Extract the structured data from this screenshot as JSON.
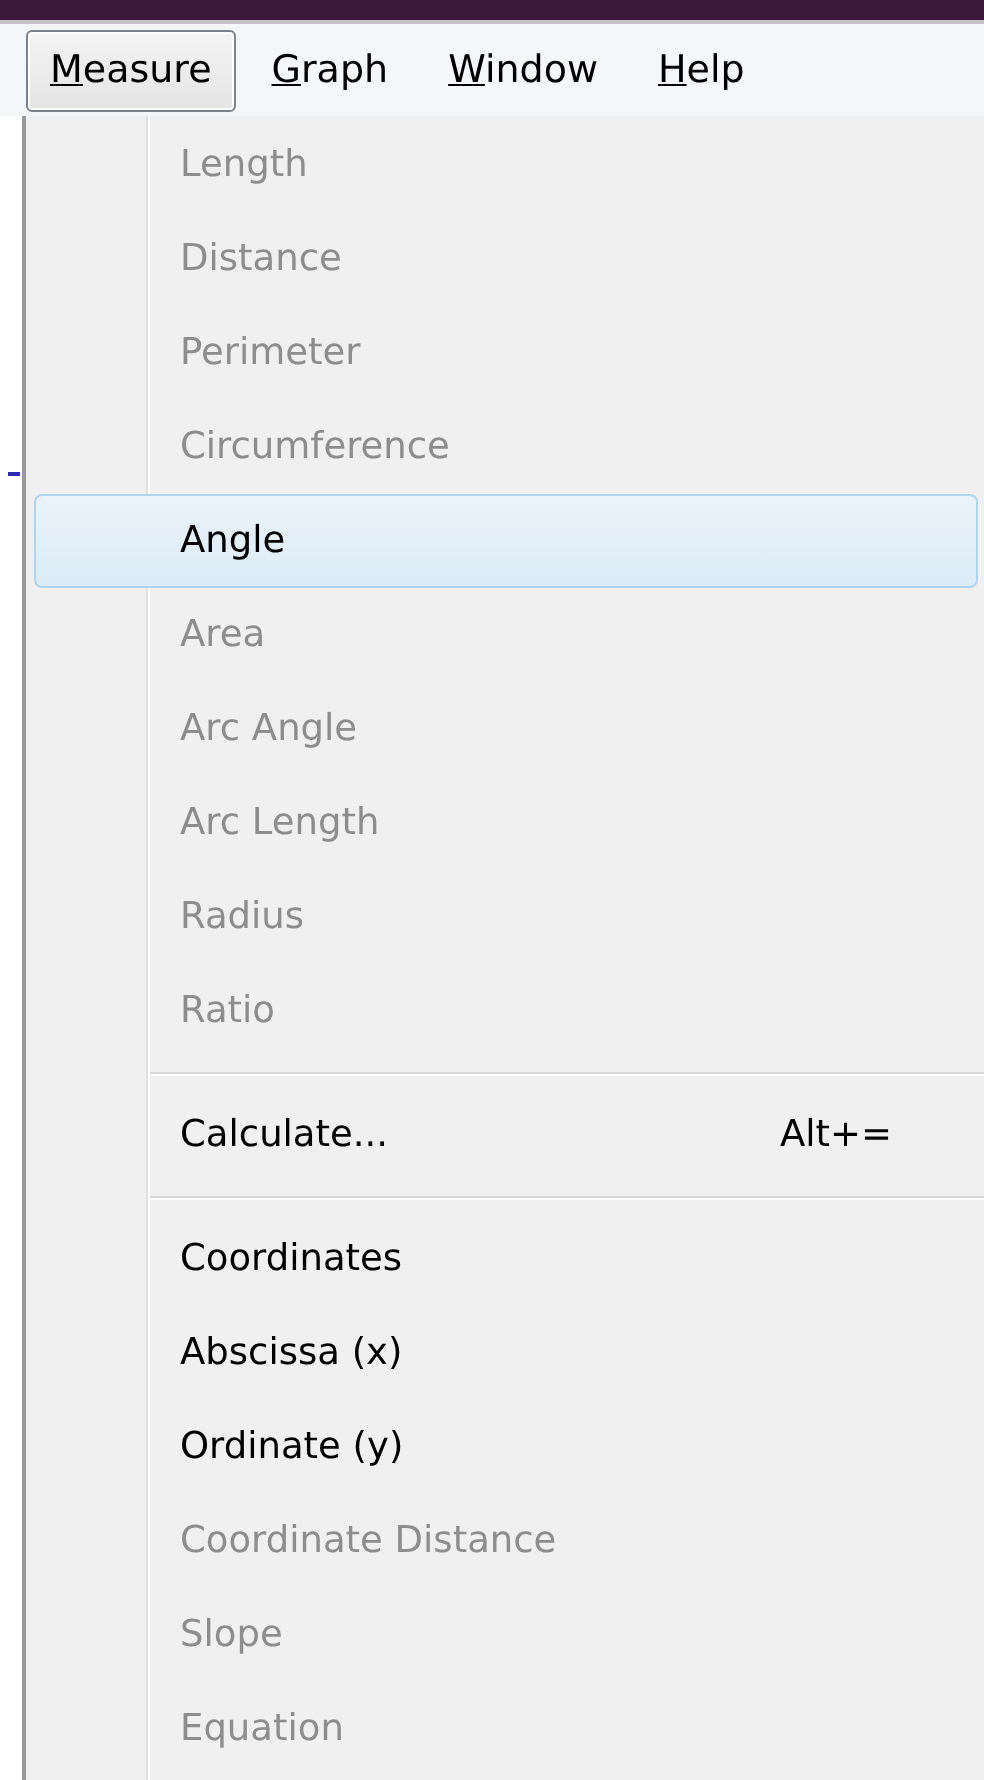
{
  "menu_bar": [
    {
      "mnemonic": "M",
      "rest": "easure",
      "selected": true
    },
    {
      "mnemonic": "G",
      "rest": "raph",
      "selected": false
    },
    {
      "mnemonic": "W",
      "rest": "indow",
      "selected": false
    },
    {
      "mnemonic": "H",
      "rest": "elp",
      "selected": false
    }
  ],
  "menu": [
    {
      "kind": "item",
      "label": "Length",
      "disabled": true,
      "selected": false
    },
    {
      "kind": "item",
      "label": "Distance",
      "disabled": true,
      "selected": false
    },
    {
      "kind": "item",
      "label": "Perimeter",
      "disabled": true,
      "selected": false
    },
    {
      "kind": "item",
      "label": "Circumference",
      "disabled": true,
      "selected": false
    },
    {
      "kind": "item",
      "label": "Angle",
      "disabled": false,
      "selected": true
    },
    {
      "kind": "item",
      "label": "Area",
      "disabled": true,
      "selected": false
    },
    {
      "kind": "item",
      "label": "Arc Angle",
      "disabled": true,
      "selected": false
    },
    {
      "kind": "item",
      "label": "Arc Length",
      "disabled": true,
      "selected": false
    },
    {
      "kind": "item",
      "label": "Radius",
      "disabled": true,
      "selected": false
    },
    {
      "kind": "item",
      "label": "Ratio",
      "disabled": true,
      "selected": false
    },
    {
      "kind": "separator"
    },
    {
      "kind": "item",
      "label": "Calculate...",
      "shortcut": "Alt+=",
      "disabled": false,
      "selected": false
    },
    {
      "kind": "separator"
    },
    {
      "kind": "item",
      "label": "Coordinates",
      "disabled": false,
      "selected": false
    },
    {
      "kind": "item",
      "label": "Abscissa (x)",
      "disabled": false,
      "selected": false
    },
    {
      "kind": "item",
      "label": "Ordinate (y)",
      "disabled": false,
      "selected": false
    },
    {
      "kind": "item",
      "label": "Coordinate Distance",
      "disabled": true,
      "selected": false
    },
    {
      "kind": "item",
      "label": "Slope",
      "disabled": true,
      "selected": false
    },
    {
      "kind": "item",
      "label": "Equation",
      "disabled": true,
      "selected": false
    }
  ]
}
